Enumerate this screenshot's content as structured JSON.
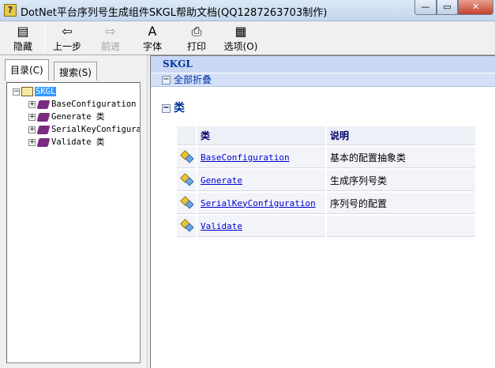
{
  "window": {
    "title": "DotNet平台序列号生成组件SKGL帮助文档(QQ1287263703制作)",
    "minimize": "—",
    "maximize": "▭",
    "close": "✕"
  },
  "toolbar": {
    "hide": "隐藏",
    "back": "上一步",
    "forward": "前进",
    "font": "字体",
    "print": "打印",
    "options": "选项(O)"
  },
  "tabs": {
    "contents": "目录(C)",
    "search": "搜索(S)"
  },
  "tree": {
    "root": "SKGL",
    "items": [
      "BaseConfiguration 类",
      "Generate 类",
      "SerialKeyConfiguration 类",
      "Validate 类"
    ]
  },
  "content": {
    "title": "SKGL",
    "collapse_all": "全部折叠",
    "section": "类",
    "table": {
      "headers": [
        "类",
        "说明"
      ],
      "rows": [
        {
          "name": "BaseConfiguration",
          "desc": "基本的配置抽象类"
        },
        {
          "name": "Generate",
          "desc": "生成序列号类"
        },
        {
          "name": "SerialKeyConfiguration",
          "desc": "序列号的配置"
        },
        {
          "name": "Validate",
          "desc": ""
        }
      ]
    }
  }
}
